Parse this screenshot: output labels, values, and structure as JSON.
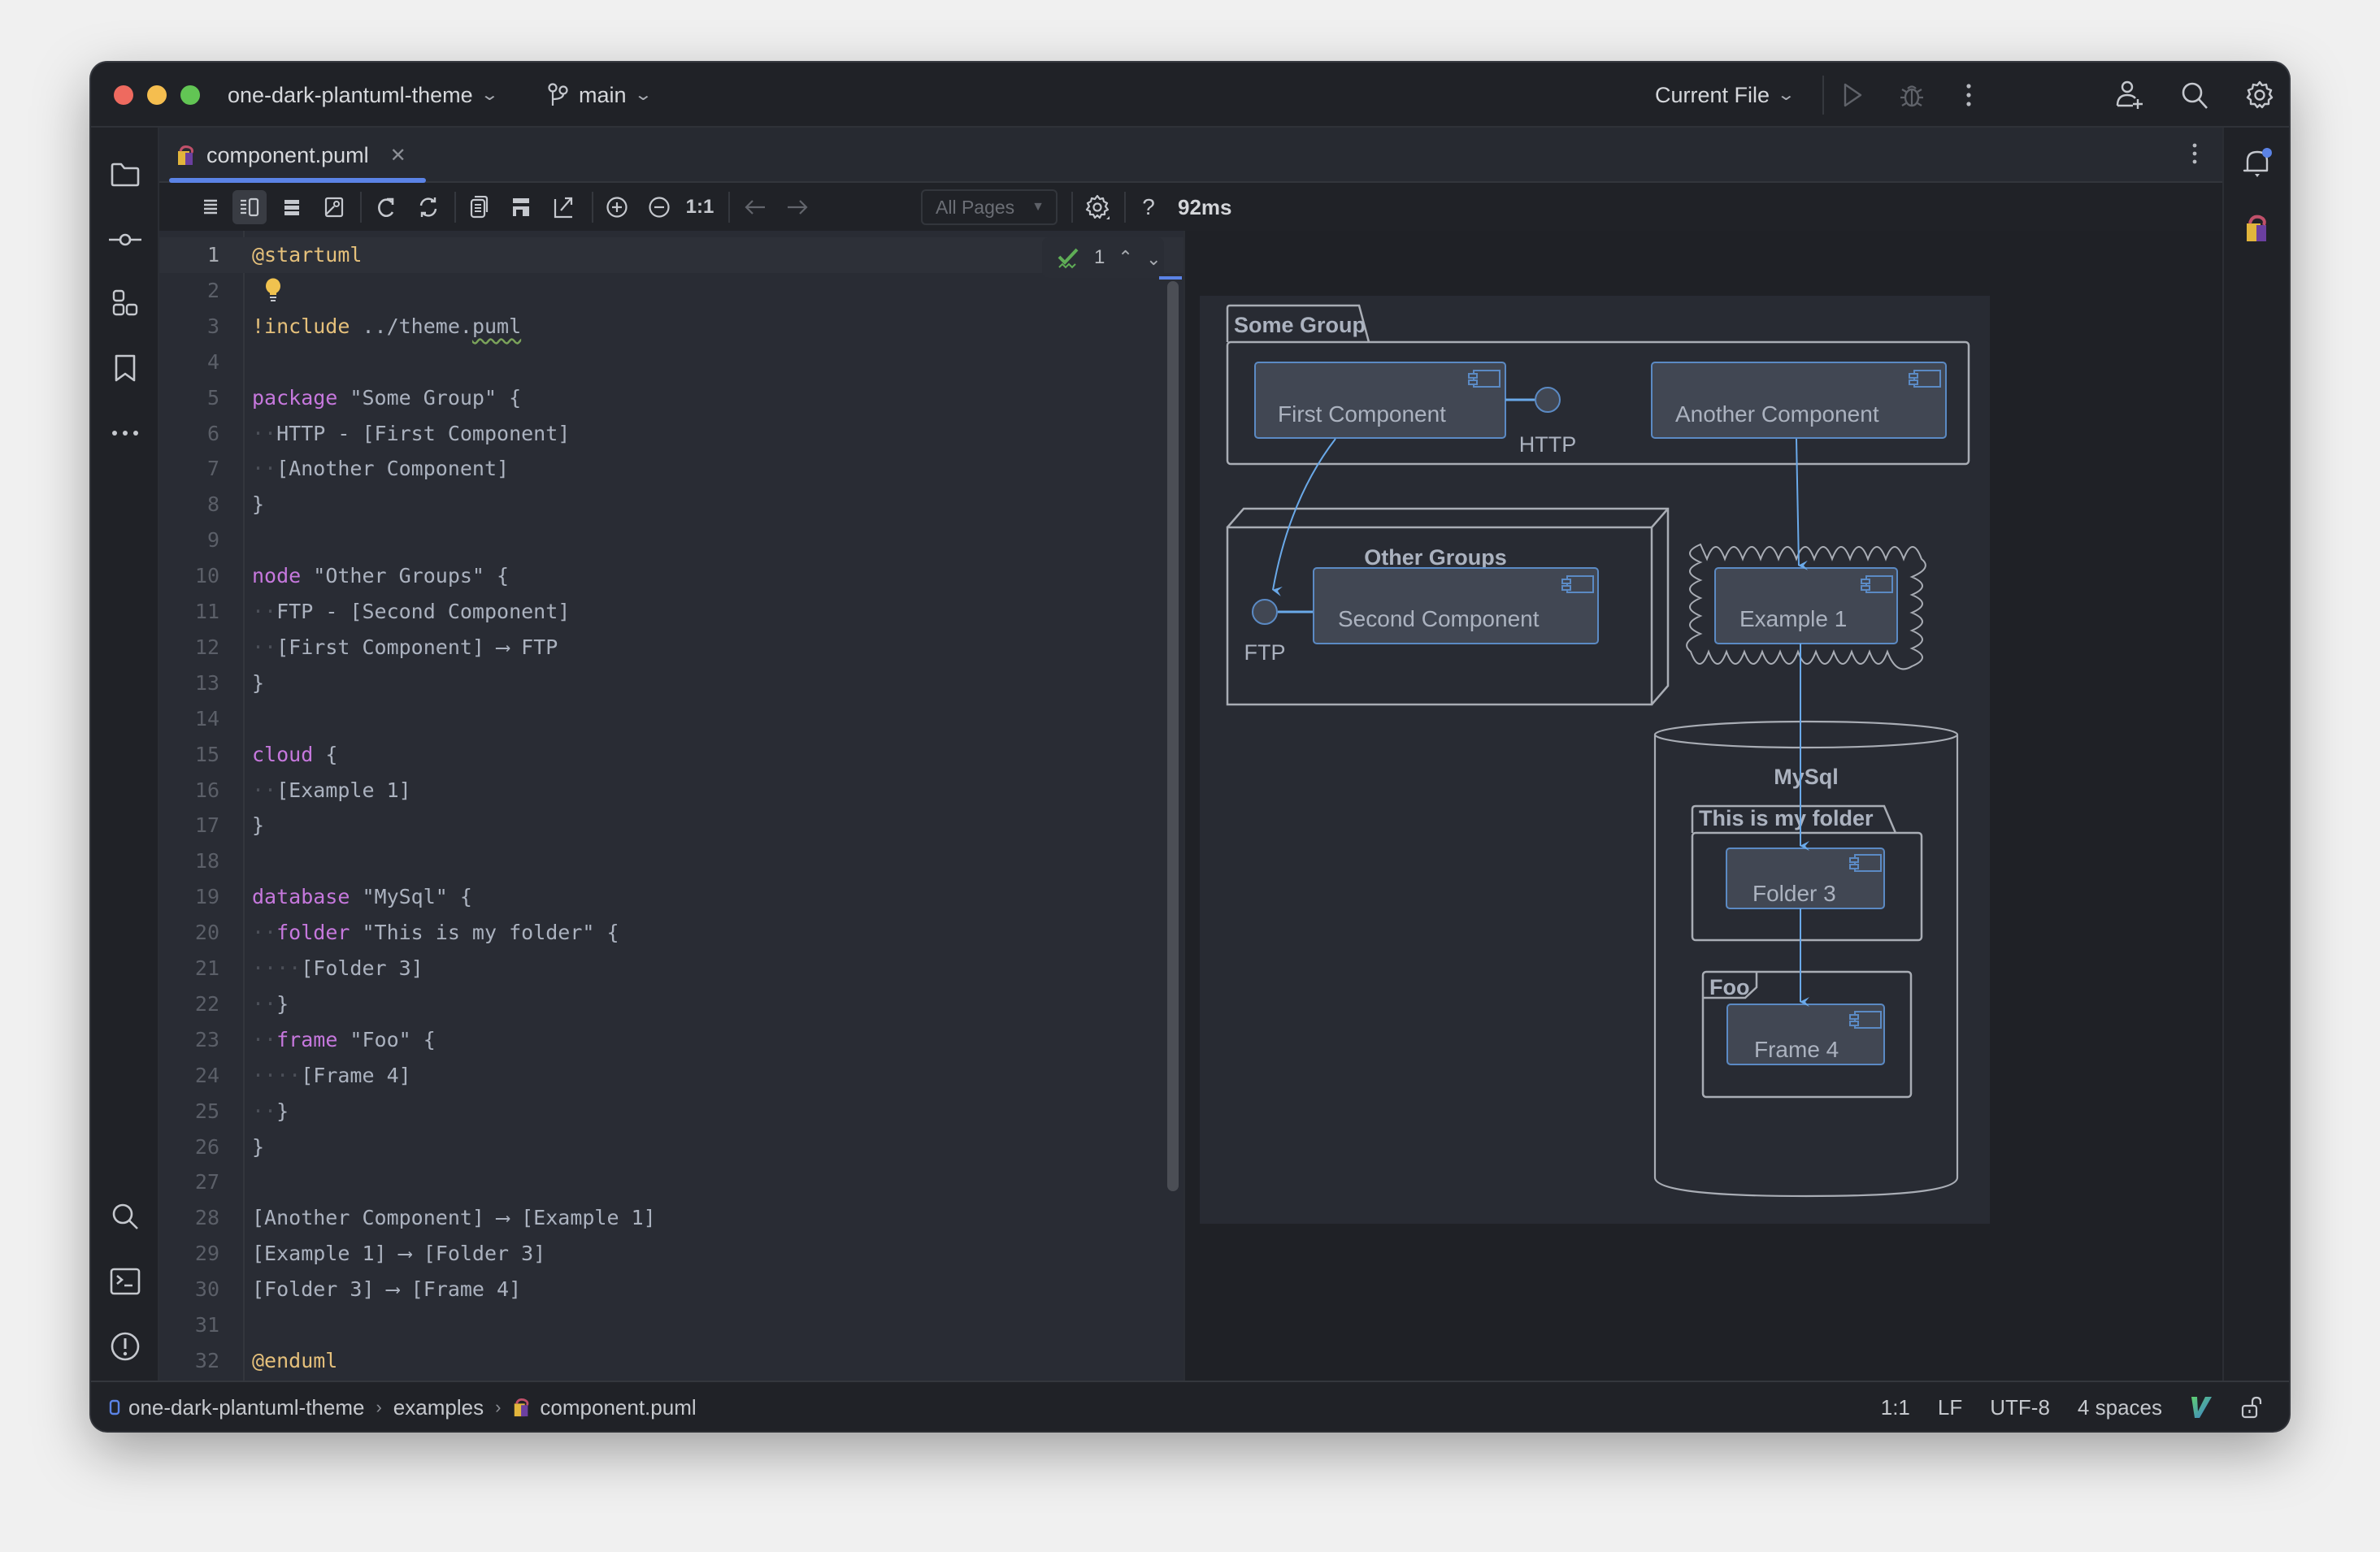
{
  "titlebar": {
    "project": "one-dark-plantuml-theme",
    "branch": "main",
    "run_config": "Current File"
  },
  "tabs": [
    {
      "label": "component.puml",
      "active": true
    }
  ],
  "toolbar": {
    "pages_select": "All Pages",
    "zoom_actual": "1:1",
    "render_time": "92ms",
    "help": "?"
  },
  "editor": {
    "inspection_count": "1",
    "lines": [
      {
        "n": "1",
        "text": "@startuml"
      },
      {
        "n": "2",
        "text": ""
      },
      {
        "n": "3",
        "text": "!include ../theme.puml"
      },
      {
        "n": "4",
        "text": ""
      },
      {
        "n": "5",
        "text": "package \"Some Group\" {"
      },
      {
        "n": "6",
        "text": "  HTTP - [First Component]"
      },
      {
        "n": "7",
        "text": "  [Another Component]"
      },
      {
        "n": "8",
        "text": "}"
      },
      {
        "n": "9",
        "text": ""
      },
      {
        "n": "10",
        "text": "node \"Other Groups\" {"
      },
      {
        "n": "11",
        "text": "  FTP - [Second Component]"
      },
      {
        "n": "12",
        "text": "  [First Component] --> FTP"
      },
      {
        "n": "13",
        "text": "}"
      },
      {
        "n": "14",
        "text": ""
      },
      {
        "n": "15",
        "text": "cloud {"
      },
      {
        "n": "16",
        "text": "  [Example 1]"
      },
      {
        "n": "17",
        "text": "}"
      },
      {
        "n": "18",
        "text": ""
      },
      {
        "n": "19",
        "text": "database \"MySql\" {"
      },
      {
        "n": "20",
        "text": "  folder \"This is my folder\" {"
      },
      {
        "n": "21",
        "text": "    [Folder 3]"
      },
      {
        "n": "22",
        "text": "  }"
      },
      {
        "n": "23",
        "text": "  frame \"Foo\" {"
      },
      {
        "n": "24",
        "text": "    [Frame 4]"
      },
      {
        "n": "25",
        "text": "  }"
      },
      {
        "n": "26",
        "text": "}"
      },
      {
        "n": "27",
        "text": ""
      },
      {
        "n": "28",
        "text": "[Another Component] --> [Example 1]"
      },
      {
        "n": "29",
        "text": "[Example 1] --> [Folder 3]"
      },
      {
        "n": "30",
        "text": "[Folder 3] --> [Frame 4]"
      },
      {
        "n": "31",
        "text": ""
      },
      {
        "n": "32",
        "text": "@enduml"
      }
    ]
  },
  "diagram": {
    "groups": {
      "some_group": "Some Group",
      "other_groups": "Other Groups",
      "mysql": "MySql",
      "folder": "This is my folder",
      "frame": "Foo"
    },
    "components": {
      "first": "First Component",
      "another": "Another Component",
      "second": "Second Component",
      "example1": "Example 1",
      "folder3": "Folder 3",
      "frame4": "Frame 4"
    },
    "interfaces": {
      "http": "HTTP",
      "ftp": "FTP"
    },
    "colors": {
      "background": "#282b33",
      "component_fill": "#414753",
      "component_border": "#5b8ac4",
      "container_stroke": "#a9adb5",
      "arrow": "#6aa9e9",
      "text": "#abb2bf"
    }
  },
  "statusbar": {
    "breadcrumb": [
      "one-dark-plantuml-theme",
      "examples",
      "component.puml"
    ],
    "position": "1:1",
    "line_ending": "LF",
    "encoding": "UTF-8",
    "indent": "4 spaces"
  }
}
